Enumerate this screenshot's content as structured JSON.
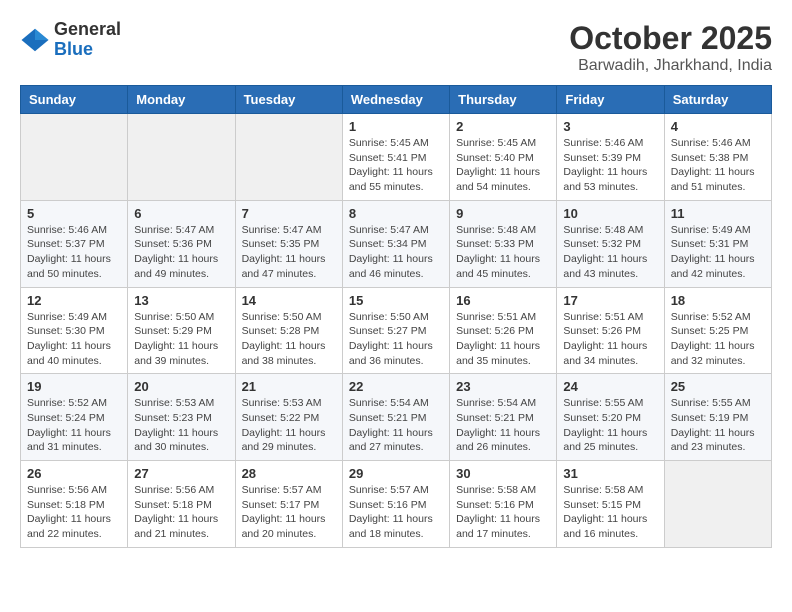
{
  "header": {
    "logo_general": "General",
    "logo_blue": "Blue",
    "month_title": "October 2025",
    "location": "Barwadih, Jharkhand, India"
  },
  "days_of_week": [
    "Sunday",
    "Monday",
    "Tuesday",
    "Wednesday",
    "Thursday",
    "Friday",
    "Saturday"
  ],
  "weeks": [
    [
      {
        "day": "",
        "info": ""
      },
      {
        "day": "",
        "info": ""
      },
      {
        "day": "",
        "info": ""
      },
      {
        "day": "1",
        "info": "Sunrise: 5:45 AM\nSunset: 5:41 PM\nDaylight: 11 hours\nand 55 minutes."
      },
      {
        "day": "2",
        "info": "Sunrise: 5:45 AM\nSunset: 5:40 PM\nDaylight: 11 hours\nand 54 minutes."
      },
      {
        "day": "3",
        "info": "Sunrise: 5:46 AM\nSunset: 5:39 PM\nDaylight: 11 hours\nand 53 minutes."
      },
      {
        "day": "4",
        "info": "Sunrise: 5:46 AM\nSunset: 5:38 PM\nDaylight: 11 hours\nand 51 minutes."
      }
    ],
    [
      {
        "day": "5",
        "info": "Sunrise: 5:46 AM\nSunset: 5:37 PM\nDaylight: 11 hours\nand 50 minutes."
      },
      {
        "day": "6",
        "info": "Sunrise: 5:47 AM\nSunset: 5:36 PM\nDaylight: 11 hours\nand 49 minutes."
      },
      {
        "day": "7",
        "info": "Sunrise: 5:47 AM\nSunset: 5:35 PM\nDaylight: 11 hours\nand 47 minutes."
      },
      {
        "day": "8",
        "info": "Sunrise: 5:47 AM\nSunset: 5:34 PM\nDaylight: 11 hours\nand 46 minutes."
      },
      {
        "day": "9",
        "info": "Sunrise: 5:48 AM\nSunset: 5:33 PM\nDaylight: 11 hours\nand 45 minutes."
      },
      {
        "day": "10",
        "info": "Sunrise: 5:48 AM\nSunset: 5:32 PM\nDaylight: 11 hours\nand 43 minutes."
      },
      {
        "day": "11",
        "info": "Sunrise: 5:49 AM\nSunset: 5:31 PM\nDaylight: 11 hours\nand 42 minutes."
      }
    ],
    [
      {
        "day": "12",
        "info": "Sunrise: 5:49 AM\nSunset: 5:30 PM\nDaylight: 11 hours\nand 40 minutes."
      },
      {
        "day": "13",
        "info": "Sunrise: 5:50 AM\nSunset: 5:29 PM\nDaylight: 11 hours\nand 39 minutes."
      },
      {
        "day": "14",
        "info": "Sunrise: 5:50 AM\nSunset: 5:28 PM\nDaylight: 11 hours\nand 38 minutes."
      },
      {
        "day": "15",
        "info": "Sunrise: 5:50 AM\nSunset: 5:27 PM\nDaylight: 11 hours\nand 36 minutes."
      },
      {
        "day": "16",
        "info": "Sunrise: 5:51 AM\nSunset: 5:26 PM\nDaylight: 11 hours\nand 35 minutes."
      },
      {
        "day": "17",
        "info": "Sunrise: 5:51 AM\nSunset: 5:26 PM\nDaylight: 11 hours\nand 34 minutes."
      },
      {
        "day": "18",
        "info": "Sunrise: 5:52 AM\nSunset: 5:25 PM\nDaylight: 11 hours\nand 32 minutes."
      }
    ],
    [
      {
        "day": "19",
        "info": "Sunrise: 5:52 AM\nSunset: 5:24 PM\nDaylight: 11 hours\nand 31 minutes."
      },
      {
        "day": "20",
        "info": "Sunrise: 5:53 AM\nSunset: 5:23 PM\nDaylight: 11 hours\nand 30 minutes."
      },
      {
        "day": "21",
        "info": "Sunrise: 5:53 AM\nSunset: 5:22 PM\nDaylight: 11 hours\nand 29 minutes."
      },
      {
        "day": "22",
        "info": "Sunrise: 5:54 AM\nSunset: 5:21 PM\nDaylight: 11 hours\nand 27 minutes."
      },
      {
        "day": "23",
        "info": "Sunrise: 5:54 AM\nSunset: 5:21 PM\nDaylight: 11 hours\nand 26 minutes."
      },
      {
        "day": "24",
        "info": "Sunrise: 5:55 AM\nSunset: 5:20 PM\nDaylight: 11 hours\nand 25 minutes."
      },
      {
        "day": "25",
        "info": "Sunrise: 5:55 AM\nSunset: 5:19 PM\nDaylight: 11 hours\nand 23 minutes."
      }
    ],
    [
      {
        "day": "26",
        "info": "Sunrise: 5:56 AM\nSunset: 5:18 PM\nDaylight: 11 hours\nand 22 minutes."
      },
      {
        "day": "27",
        "info": "Sunrise: 5:56 AM\nSunset: 5:18 PM\nDaylight: 11 hours\nand 21 minutes."
      },
      {
        "day": "28",
        "info": "Sunrise: 5:57 AM\nSunset: 5:17 PM\nDaylight: 11 hours\nand 20 minutes."
      },
      {
        "day": "29",
        "info": "Sunrise: 5:57 AM\nSunset: 5:16 PM\nDaylight: 11 hours\nand 18 minutes."
      },
      {
        "day": "30",
        "info": "Sunrise: 5:58 AM\nSunset: 5:16 PM\nDaylight: 11 hours\nand 17 minutes."
      },
      {
        "day": "31",
        "info": "Sunrise: 5:58 AM\nSunset: 5:15 PM\nDaylight: 11 hours\nand 16 minutes."
      },
      {
        "day": "",
        "info": ""
      }
    ]
  ]
}
